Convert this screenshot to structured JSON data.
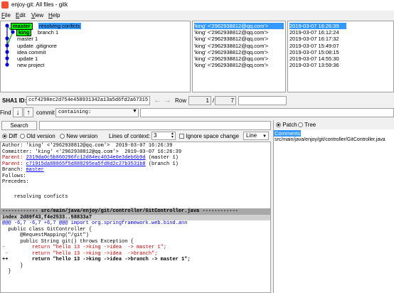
{
  "window": {
    "title": "enjoy-git: All files - gitk"
  },
  "menu": [
    {
      "label": "File",
      "accel": "F",
      "rest": "ile"
    },
    {
      "label": "Edit",
      "accel": "E",
      "rest": "dit"
    },
    {
      "label": "View",
      "accel": "V",
      "rest": "iew"
    },
    {
      "label": "Help",
      "accel": "H",
      "rest": "elp"
    }
  ],
  "graph": {
    "branch_master": "master",
    "branch_king": "king",
    "commits": [
      "resolving conficts",
      "branch 1",
      "master 1",
      "update .gitignore",
      "idea commit",
      "update 1",
      "new project"
    ]
  },
  "authors": [
    "'king' <'2962938812@qq.com'>",
    "'king' <'2962938812@qq.com'>",
    "'king' <'2962938812@qq.com'>",
    "'king' <'2962938812@qq.com'>",
    "'king' <'2962938812@qq.com'>",
    "'king' <'2962938812@qq.com'>",
    "'king' <'2962938812@qq.com'>"
  ],
  "dates": [
    "2019-03-07 16:26:39",
    "2019-03-07 16:12:24",
    "2019-03-07 16:17:32",
    "2019-03-07 15:49:07",
    "2019-03-07 15:08:15",
    "2019-03-07 14:55:30",
    "2019-03-07 13:59:36"
  ],
  "sha": {
    "label": "SHA1 ID:",
    "value": "ccf4298ec2d754e458931342a13a5d6fd2a67315",
    "row_label": "Row",
    "row_current": "1",
    "row_sep": "/",
    "row_total": "7"
  },
  "find": {
    "label": "Find",
    "commit_label": "commit",
    "mode": "containing:",
    "search_button": "Search"
  },
  "diff_options": {
    "diff": "Diff",
    "old": "Old version",
    "new": "New version",
    "context_label": "Lines of context:",
    "context_value": "3",
    "ignore_space": "Ignore space change",
    "line_mode": "Line"
  },
  "right_panel": {
    "patch": "Patch",
    "tree": "Tree",
    "comments": "Comments",
    "file": "src/main/java/enjoy/git/controller/GitController.java"
  },
  "diff_lines": [
    {
      "text": "Author: 'king' <'2962938812@qq.com'>  2019-03-07 16:26:39",
      "cls": ""
    },
    {
      "text": "Committer: 'king' <'2962938812@qq.com'>  2019-03-07 16:26:39",
      "cls": ""
    },
    {
      "prefix": "Parent: ",
      "link": "2319da0c5b860296fc12d84ec4034e0e3deb6b9d",
      "suffix": " (master 1)",
      "cls": "red"
    },
    {
      "prefix": "Parent: ",
      "link": "c71915da88865f5d888295ea5fd8d2c27b3531b8",
      "suffix": " (branch 1)",
      "cls": "red"
    },
    {
      "prefix": "Branch: ",
      "link": "master",
      "suffix": "",
      "cls": ""
    },
    {
      "text": "Follows:",
      "cls": ""
    },
    {
      "text": "Precedes:",
      "cls": ""
    },
    {
      "text": "",
      "cls": ""
    },
    {
      "text": "    resolving conficts",
      "cls": ""
    },
    {
      "text": "",
      "cls": ""
    },
    {
      "text": "------------ src/main/java/enjoy/git/controller/GitController.java ------------",
      "cls": "filehdr"
    },
    {
      "text": "index 2d89f43,f4e2533..58833a7",
      "cls": "index"
    },
    {
      "text": "@@@ -6,7 -6,7 +6,7 @@@ import org.springframework.web.bind.ann",
      "cls": "blue"
    },
    {
      "text": "  public class GitController {",
      "cls": ""
    },
    {
      "text": "      @RequestMapping(\"/git\")",
      "cls": ""
    },
    {
      "text": "      public String git() throws Exception {",
      "cls": ""
    },
    {
      "text": "-         return \"hello 13 ->king ->idea  -> master 1\";",
      "cls": "red"
    },
    {
      "text": " -        return \"hello 13 ->king ->idea  ->branch\";",
      "cls": "red"
    },
    {
      "text": "++        return \"hello 13 ->king ->idea ->branch -> master 1\";",
      "cls": "bold"
    },
    {
      "text": "      }",
      "cls": ""
    },
    {
      "text": "  }",
      "cls": ""
    }
  ]
}
